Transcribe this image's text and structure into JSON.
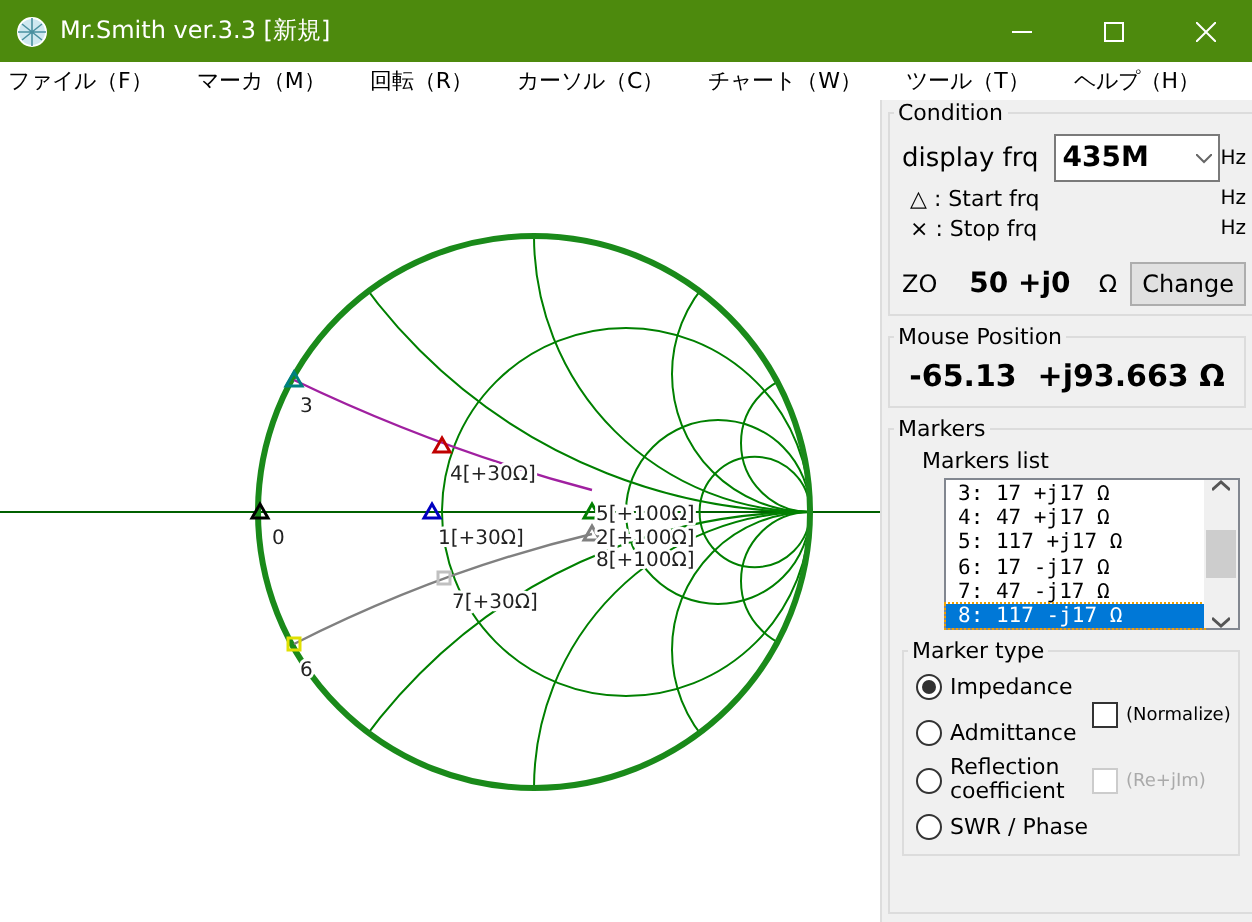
{
  "window": {
    "title": "Mr.Smith ver.3.3 [新規]"
  },
  "menu": [
    "ファイル（F）",
    "マーカ（M）",
    "回転（R）",
    "カーソル（C）",
    "チャート（W）",
    "ツール（T）",
    "ヘルプ（H）"
  ],
  "chart": {
    "markers": [
      {
        "label": "0",
        "color": "#000000",
        "kind": "triangle"
      },
      {
        "label": "1[+30Ω]",
        "color": "#0000c0",
        "kind": "triangle"
      },
      {
        "label": "2[+100Ω]",
        "color": "#808080",
        "kind": "triangle"
      },
      {
        "label": "3",
        "color": "#008080",
        "kind": "triangle"
      },
      {
        "label": "4[+30Ω]",
        "color": "#c00000",
        "kind": "triangle"
      },
      {
        "label": "5[+100Ω]",
        "color": "#008000",
        "kind": "triangle"
      },
      {
        "label": "6",
        "color": "#e0e000",
        "kind": "square"
      },
      {
        "label": "7[+30Ω]",
        "color": "#c0c0c0",
        "kind": "square"
      },
      {
        "label": "8[+100Ω]",
        "kind": "none"
      }
    ]
  },
  "condition": {
    "title": "Condition",
    "display_frq_label": "display frq",
    "display_frq": "435M",
    "display_frq_unit": "Hz",
    "start_label": "△ : Start frq",
    "start_unit": "Hz",
    "stop_label": "× : Stop frq",
    "stop_unit": "Hz",
    "z0_label": "ZO",
    "z0_value": "50 +j0",
    "z0_unit": "Ω",
    "change_button": "Change"
  },
  "mouse_position": {
    "title": "Mouse Position",
    "value": "-65.13  +j93.663 Ω"
  },
  "markers": {
    "title": "Markers",
    "list_label": "Markers list",
    "items": [
      {
        "text": "3: 17 +j17 Ω",
        "selected": false
      },
      {
        "text": "4: 47 +j17 Ω",
        "selected": false
      },
      {
        "text": "5: 117 +j17 Ω",
        "selected": false
      },
      {
        "text": "6: 17 -j17 Ω",
        "selected": false
      },
      {
        "text": "7: 47 -j17 Ω",
        "selected": false
      },
      {
        "text": "8: 117 -j17 Ω",
        "selected": true
      }
    ],
    "marker_type": {
      "title": "Marker type",
      "options": [
        {
          "label": "Impedance",
          "selected": true
        },
        {
          "label": "Admittance",
          "selected": false
        },
        {
          "label": "Reflection coefficient",
          "selected": false
        },
        {
          "label": "SWR / Phase",
          "selected": false
        }
      ],
      "normalize": {
        "label": "(Normalize)",
        "checked": false,
        "disabled": false
      },
      "re_im": {
        "label": "(Re+jIm)",
        "checked": false,
        "disabled": true
      }
    }
  }
}
